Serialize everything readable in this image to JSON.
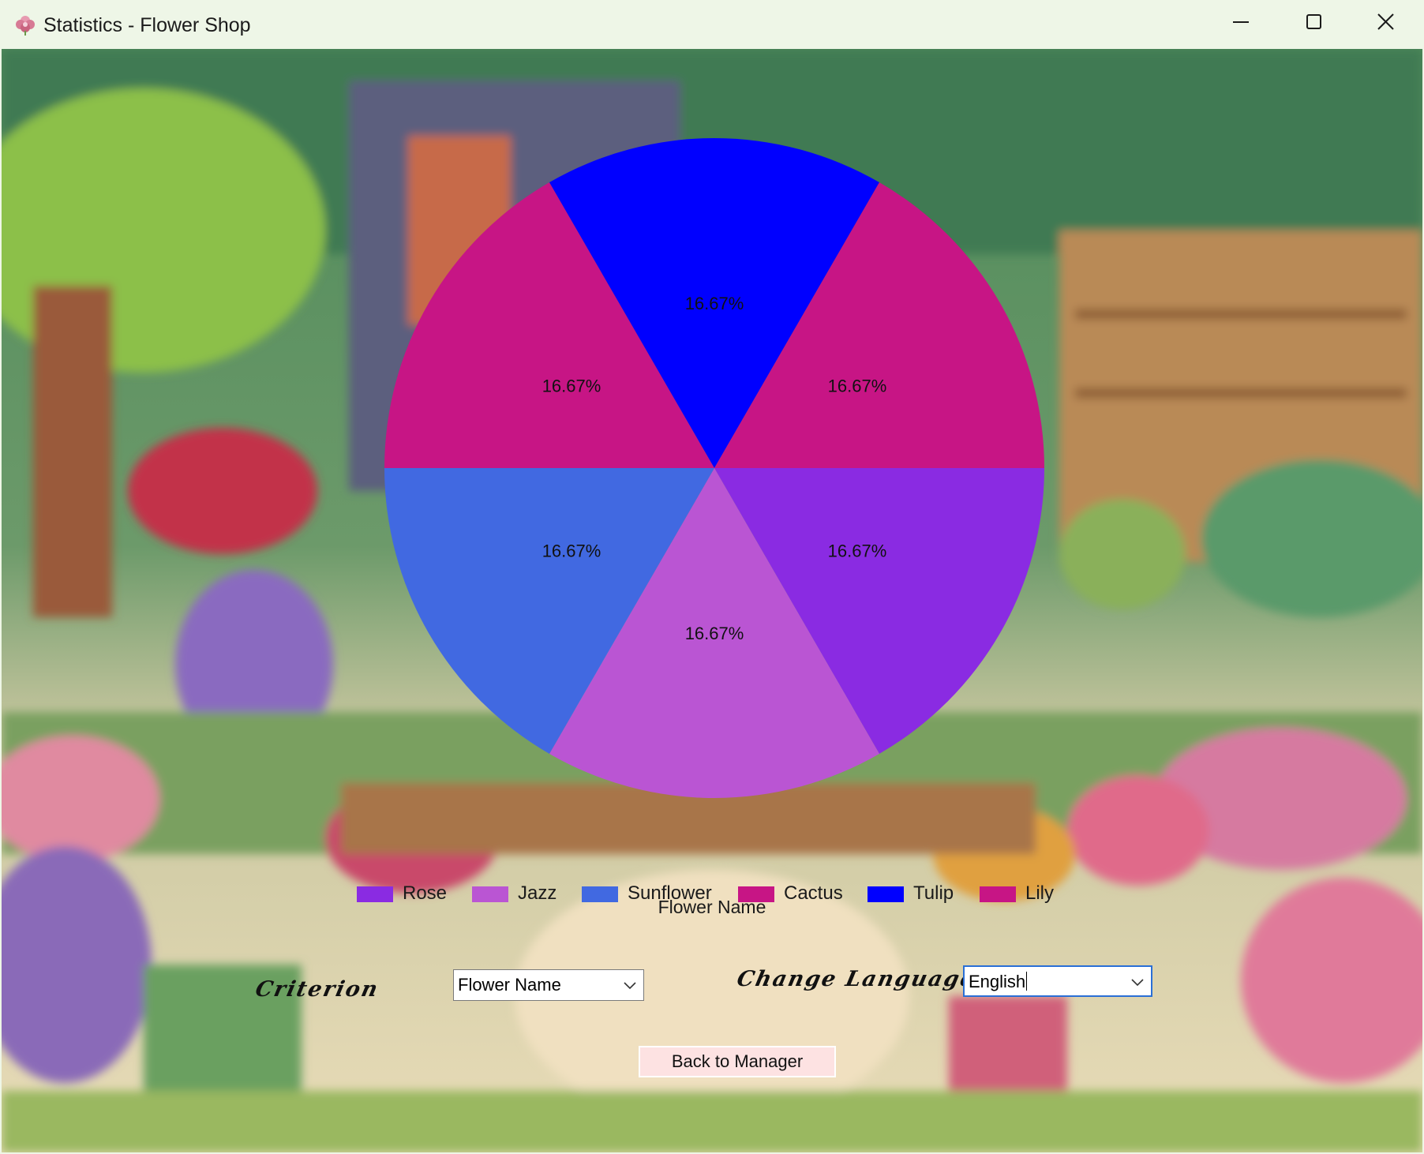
{
  "window": {
    "title": "Statistics - Flower Shop",
    "icon": "flower-app-icon",
    "controls": [
      "minimize-icon",
      "maximize-icon",
      "close-icon"
    ]
  },
  "chart_data": {
    "type": "pie",
    "title": "",
    "legend_title": "Flower Name",
    "legend_position": "bottom",
    "slices": [
      {
        "label": "Rose",
        "value": 16.67,
        "percent_label": "16.67%",
        "color": "#8a2be2"
      },
      {
        "label": "Jazz",
        "value": 16.67,
        "percent_label": "16.67%",
        "color": "#ba55d3"
      },
      {
        "label": "Sunflower",
        "value": 16.67,
        "percent_label": "16.67%",
        "color": "#4169e1"
      },
      {
        "label": "Cactus",
        "value": 16.67,
        "percent_label": "16.67%",
        "color": "#c71585"
      },
      {
        "label": "Tulip",
        "value": 16.67,
        "percent_label": "16.67%",
        "color": "#0000ff"
      },
      {
        "label": "Lily",
        "value": 16.67,
        "percent_label": "16.67%",
        "color": "#c71585"
      }
    ]
  },
  "controls": {
    "criterion_label": "Criterion",
    "criterion_value": "Flower Name",
    "language_label": "Change Language",
    "language_value": "English",
    "back_button": "Back to Manager"
  }
}
